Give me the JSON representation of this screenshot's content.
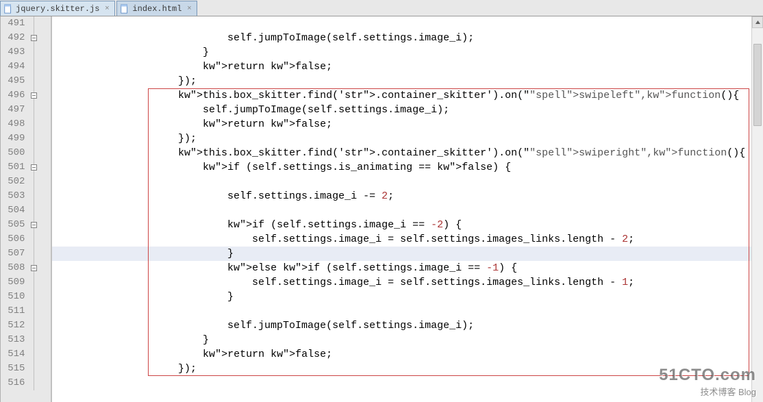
{
  "tabs": [
    {
      "label": "jquery.skitter.js",
      "active": true
    },
    {
      "label": "index.html",
      "active": false
    }
  ],
  "lineStart": 491,
  "lineEnd": 516,
  "highlightedLine": 507,
  "redBox": {
    "startLine": 496,
    "endLine": 515
  },
  "foldMarkers": {
    "minusAt": [
      492,
      496,
      501,
      505,
      508
    ],
    "closeAt": [
      494,
      510,
      514
    ]
  },
  "code": {
    "491": "                                                                            ",
    "492": "                            self.jumpToImage(self.settings.image_i);",
    "493": "                        }",
    "494": "                        return false;",
    "495": "                    });",
    "496": "                    this.box_skitter.find('.container_skitter').on(\"swipeleft\",function(){",
    "497": "                        self.jumpToImage(self.settings.image_i);",
    "498": "                        return false;",
    "499": "                    });",
    "500": "                    this.box_skitter.find('.container_skitter').on(\"swiperight\",function(){",
    "501": "                        if (self.settings.is_animating == false) {",
    "502": "                                                                            ",
    "503": "                            self.settings.image_i -= 2;",
    "504": "                                                                            ",
    "505": "                            if (self.settings.image_i == -2) {",
    "506": "                                self.settings.image_i = self.settings.images_links.length - 2;",
    "507": "                            }",
    "508": "                            else if (self.settings.image_i == -1) {",
    "509": "                                self.settings.image_i = self.settings.images_links.length - 1;",
    "510": "                            }",
    "511": "                                                                            ",
    "512": "                            self.jumpToImage(self.settings.image_i);",
    "513": "                        }",
    "514": "                        return false;",
    "515": "                    });",
    "516": ""
  },
  "watermark": {
    "big": "51CTO.com",
    "small": "技术博客        Blog"
  }
}
